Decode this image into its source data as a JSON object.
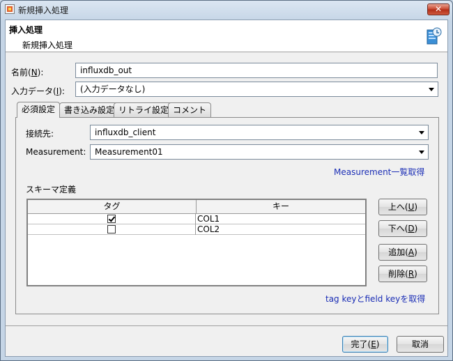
{
  "window": {
    "title": "新規挿入処理",
    "close_label": "✕"
  },
  "header": {
    "title": "挿入処理",
    "subtitle": "新規挿入処理",
    "icon": "database-insert-icon"
  },
  "form": {
    "name_label_pre": "名前(",
    "name_mnemonic": "N",
    "name_label_post": "):",
    "name_value": "influxdb_out",
    "input_label_pre": "入力データ(",
    "input_mnemonic": "I",
    "input_label_post": "):",
    "input_value": "(入力データなし)"
  },
  "tabs": [
    {
      "label": "必須設定",
      "active": true
    },
    {
      "label": "書き込み設定",
      "active": false
    },
    {
      "label": "リトライ設定",
      "active": false
    },
    {
      "label": "コメント",
      "active": false
    }
  ],
  "required": {
    "destination_label": "接続先:",
    "destination_value": "influxdb_client",
    "measurement_label": "Measurement:",
    "measurement_value": "Measurement01",
    "measurement_list_link": "Measurement一覧取得",
    "schema_label": "スキーマ定義",
    "table": {
      "columns": [
        "タグ",
        "キー"
      ],
      "rows": [
        {
          "tag": true,
          "key": "COL1"
        },
        {
          "tag": false,
          "key": "COL2"
        }
      ]
    },
    "up_label_pre": "上へ(",
    "up_mnemonic": "U",
    "up_label_post": ")",
    "down_label_pre": "下へ(",
    "down_mnemonic": "D",
    "down_label_post": ")",
    "add_label_pre": "追加(",
    "add_mnemonic": "A",
    "add_label_post": ")",
    "delete_label_pre": "削除(",
    "delete_mnemonic": "R",
    "delete_label_post": ")",
    "tagkey_link": "tag keyとfield keyを取得"
  },
  "footer": {
    "finish_label_pre": "完了(",
    "finish_mnemonic": "E",
    "finish_label_post": ")",
    "cancel_label": "取消"
  }
}
